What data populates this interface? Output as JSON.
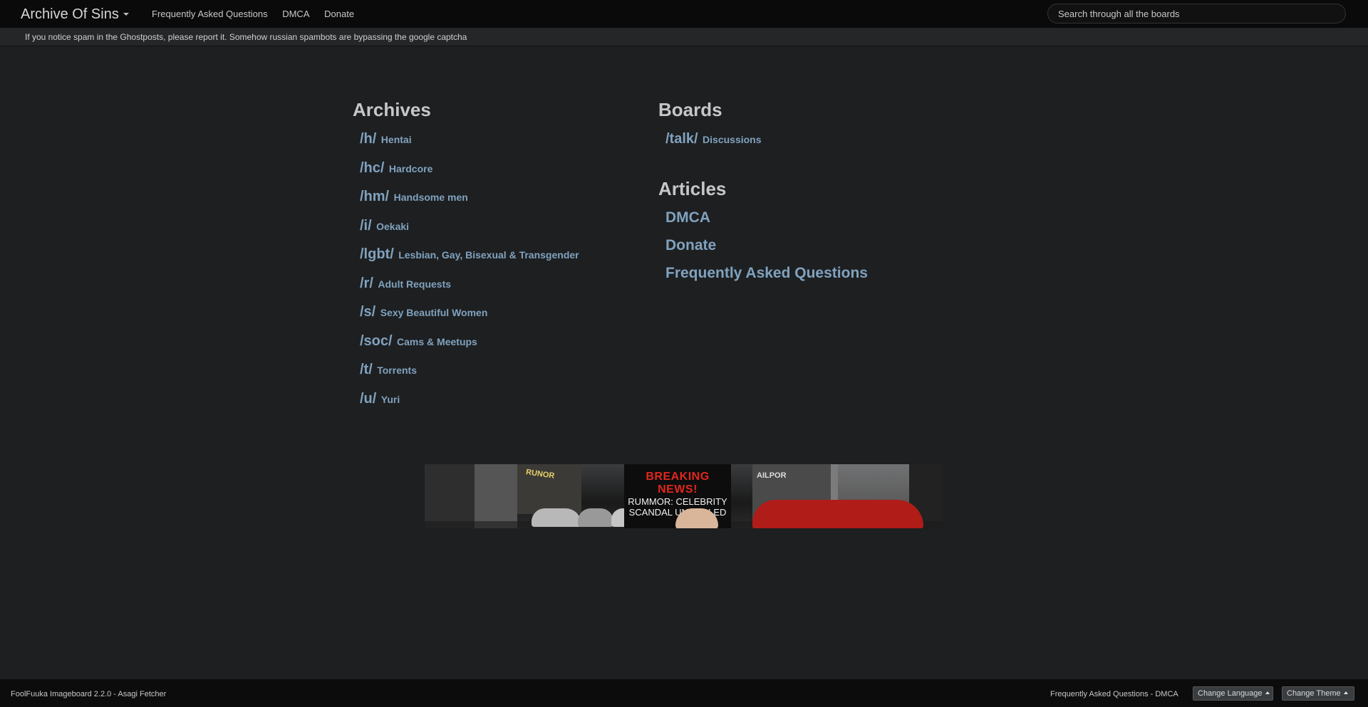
{
  "header": {
    "brand": "Archive Of Sins",
    "nav": [
      "Frequently Asked Questions",
      "DMCA",
      "Donate"
    ],
    "search_placeholder": "Search through all the boards"
  },
  "notice": "If you notice spam in the Ghostposts, please report it. Somehow russian spambots are bypassing the google captcha",
  "archives": {
    "title": "Archives",
    "boards": [
      {
        "code": "/h/",
        "name": "Hentai"
      },
      {
        "code": "/hc/",
        "name": "Hardcore"
      },
      {
        "code": "/hm/",
        "name": "Handsome men"
      },
      {
        "code": "/i/",
        "name": "Oekaki"
      },
      {
        "code": "/lgbt/",
        "name": "Lesbian, Gay, Bisexual & Transgender"
      },
      {
        "code": "/r/",
        "name": "Adult Requests"
      },
      {
        "code": "/s/",
        "name": "Sexy Beautiful Women"
      },
      {
        "code": "/soc/",
        "name": "Cams & Meetups"
      },
      {
        "code": "/t/",
        "name": "Torrents"
      },
      {
        "code": "/u/",
        "name": "Yuri"
      }
    ]
  },
  "boards": {
    "title": "Boards",
    "items": [
      {
        "code": "/talk/",
        "name": "Discussions"
      }
    ]
  },
  "articles": {
    "title": "Articles",
    "items": [
      "DMCA",
      "Donate",
      "Frequently Asked Questions"
    ]
  },
  "banner": {
    "headline": "BREAKING NEWS!",
    "line1": "RUMMOR: CELEBRITY",
    "line2": "SCANDAL UNVEILLED",
    "sign_left": "RUNOR",
    "sign_right": "AILPOR"
  },
  "footer": {
    "version": "FoolFuuka Imageboard 2.2.0 - Asagi Fetcher",
    "link_faq": "Frequently Asked Questions",
    "separator": " - ",
    "link_dmca": "DMCA",
    "change_language": "Change Language",
    "change_theme": "Change Theme"
  }
}
